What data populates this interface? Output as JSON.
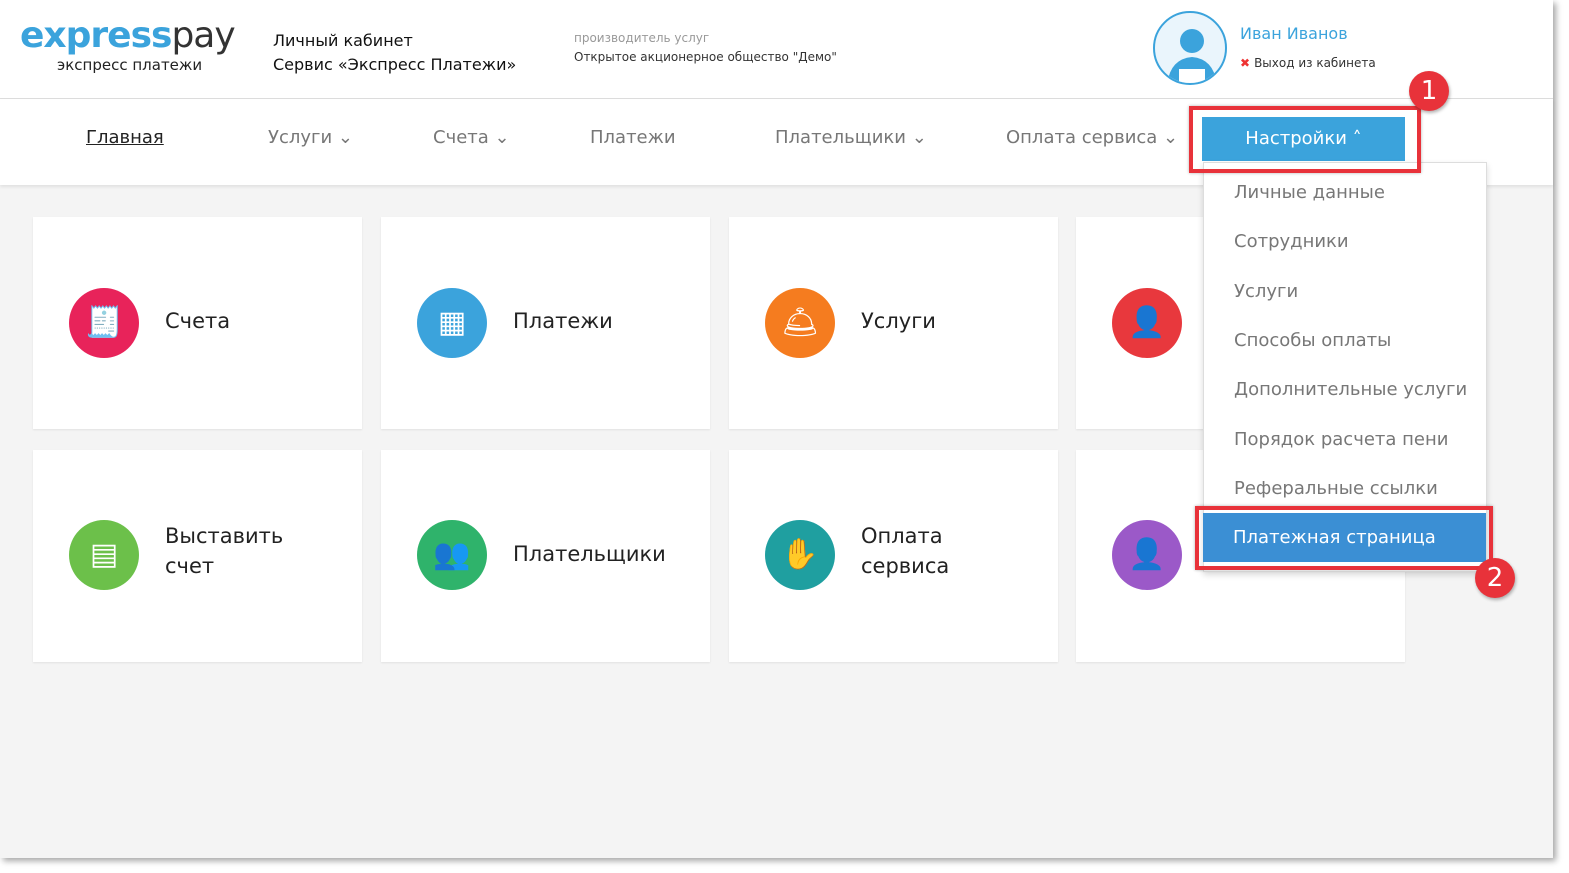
{
  "header": {
    "logo_main": "express",
    "logo_pay": "pay",
    "logo_sub": "экспресс платежи",
    "cabinet": "Личный кабинет",
    "service": "Сервис «Экспресс Платежи»",
    "provider_label": "производитель услуг",
    "provider": "Открытое акционерное общество \"Демо\"",
    "user": "Иван Иванов",
    "logout": "Выход из кабинета"
  },
  "nav": {
    "items": [
      "Главная",
      "Услуги ⌄",
      "Счета ⌄",
      "Платежи",
      "Плательщики ⌄",
      "Оплата сервиса ⌄"
    ],
    "settings": "Настройки ˄"
  },
  "cards": [
    {
      "label": "Счета",
      "color": "#e8235a",
      "icon": "invoice-icon"
    },
    {
      "label": "Платежи",
      "color": "#3ba3dc",
      "icon": "calculator-icon"
    },
    {
      "label": "Услуги",
      "color": "#f57c1f",
      "icon": "service-bell-icon"
    },
    {
      "label": "",
      "color": "#e8383d",
      "icon": "user-icon"
    },
    {
      "label": "Выставить счет",
      "color": "#6cc04a",
      "icon": "cash-register-icon"
    },
    {
      "label": "Плательщики",
      "color": "#2fb36b",
      "icon": "group-icon"
    },
    {
      "label": "Оплата сервиса",
      "color": "#1f9fa0",
      "icon": "payment-hand-icon"
    },
    {
      "label": "",
      "color": "#9b59c8",
      "icon": "employee-icon"
    }
  ],
  "menu": {
    "items": [
      "Личные данные",
      "Сотрудники",
      "Услуги",
      "Способы оплаты",
      "Дополнительные услуги",
      "Порядок расчета пени",
      "Реферальные ссылки"
    ],
    "active": "Платежная страница"
  },
  "annotations": [
    "1",
    "2"
  ]
}
